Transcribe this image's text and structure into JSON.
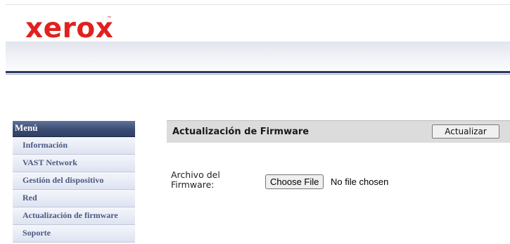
{
  "brand": {
    "logo_text": "xerox",
    "trademark": "™"
  },
  "menu": {
    "title": "Menú",
    "items": [
      {
        "label": "Información"
      },
      {
        "label": "VAST Network"
      },
      {
        "label": "Gestión del dispositivo"
      },
      {
        "label": "Red"
      },
      {
        "label": "Actualización de firmware"
      },
      {
        "label": "Soporte"
      }
    ]
  },
  "content": {
    "title": "Actualización de Firmware",
    "update_button": "Actualizar",
    "field_label": "Archivo del Firmware:",
    "choose_file_button": "Choose File",
    "file_status": "No file chosen"
  },
  "colors": {
    "brand_red": "#e0211d",
    "navy": "#2b3a63",
    "menu_text": "#4b5a82"
  }
}
